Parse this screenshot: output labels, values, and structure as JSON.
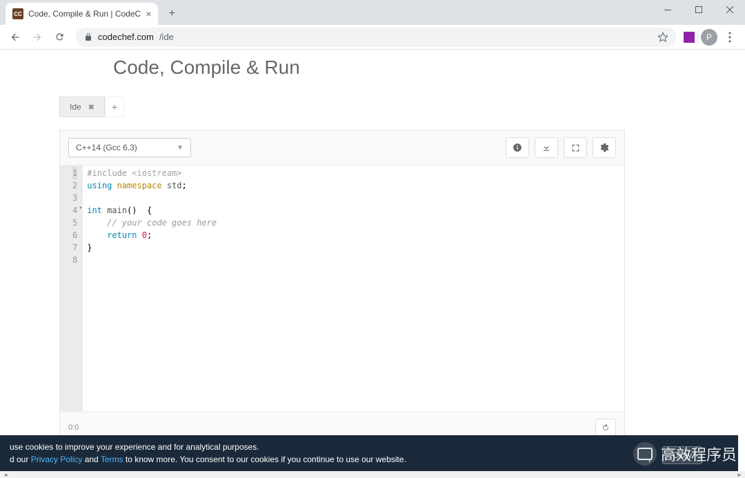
{
  "window": {
    "title": "Code, Compile & Run | CodeC"
  },
  "url": {
    "host": "codechef.com",
    "path": "/ide"
  },
  "avatar": "P",
  "page": {
    "heading": "Code, Compile & Run"
  },
  "ideTabs": {
    "active": "Ide"
  },
  "lang": "C++14 (Gcc 6.3)",
  "status": "0:0",
  "code": {
    "l1a": "#include ",
    "l1b": "<iostream>",
    "l2a": "using ",
    "l2b": "namespace ",
    "l2c": "std",
    "l2d": ";",
    "l3": "",
    "l4a": "int ",
    "l4b": "main",
    "l4c": "()  {",
    "l5": "    // your code goes here",
    "l6a": "    ",
    "l6b": "return ",
    "l6c": "0",
    "l6d": ";",
    "l7": "}",
    "l8": ""
  },
  "cookie": {
    "line1": "use cookies to improve your experience and for analytical purposes.",
    "line2a": "d our ",
    "privacy": "Privacy Policy",
    "and": " and ",
    "terms": "Terms",
    "line2b": " to know more. You consent to our cookies if you continue to use our website.",
    "btn": "Okay"
  },
  "watermark": "高效程序员"
}
